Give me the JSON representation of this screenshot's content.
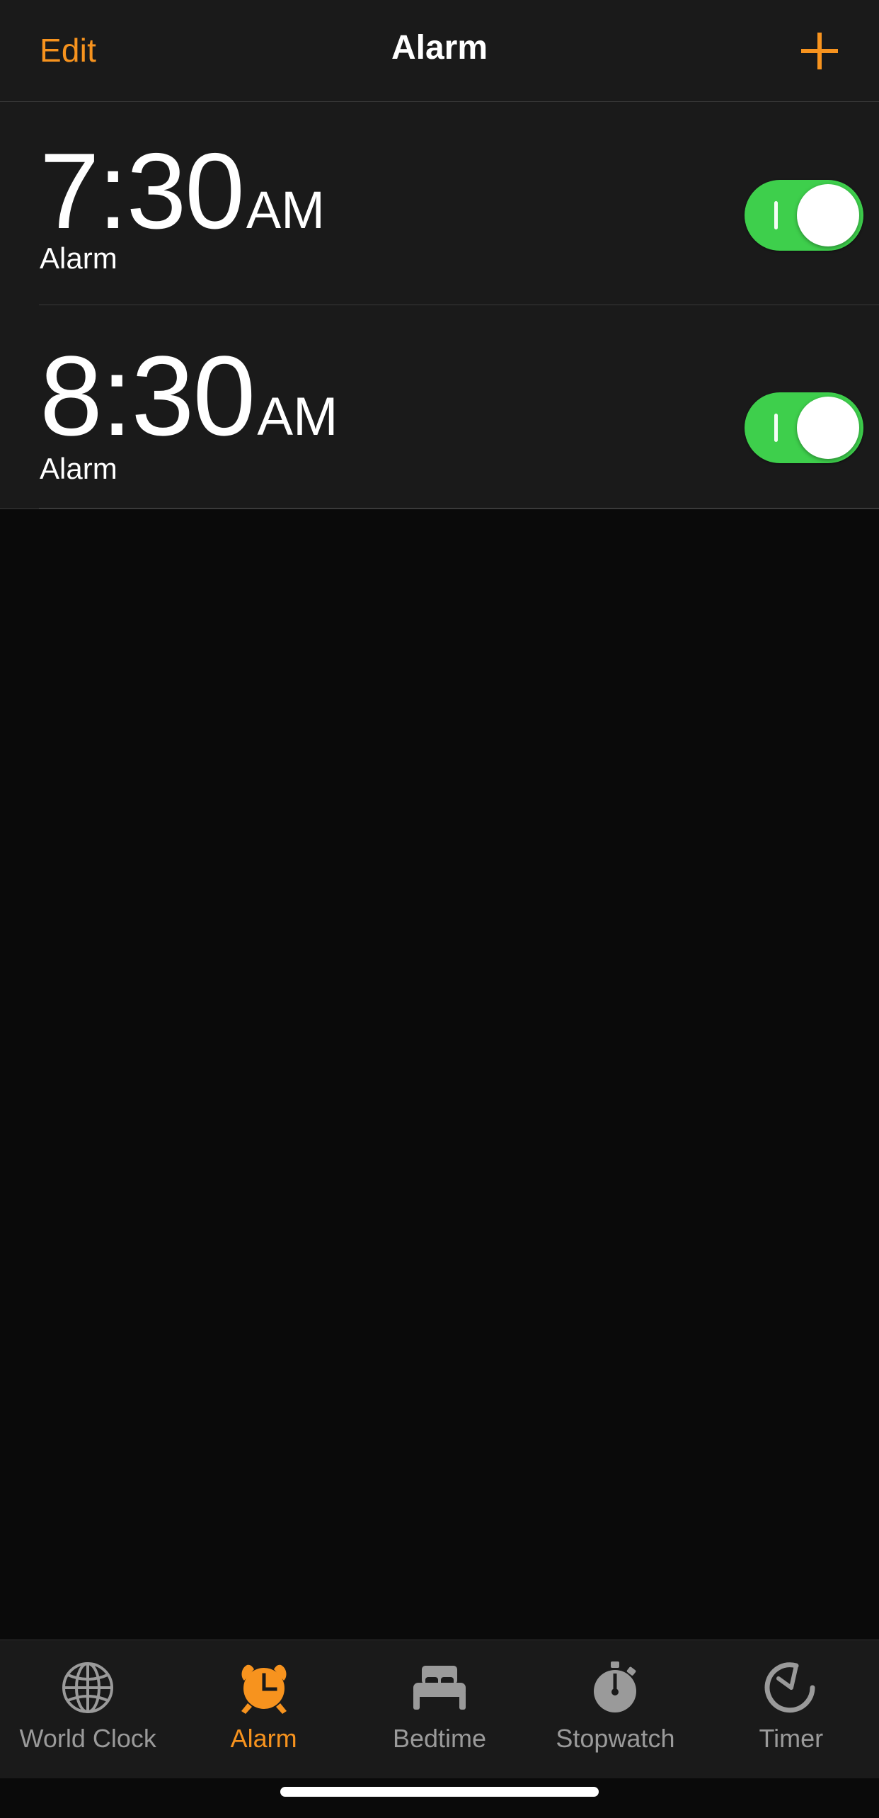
{
  "colors": {
    "accent": "#f7931e",
    "toggle_on": "#3ecf4c",
    "row_background": "#1a1a1a",
    "screen_background": "#0a0a0a",
    "inactive_tab": "#9a9a9a",
    "divider": "#3a3a3a",
    "text_primary": "#ffffff"
  },
  "navbar": {
    "edit_label": "Edit",
    "title": "Alarm",
    "add_icon": "plus-icon"
  },
  "alarms": [
    {
      "time": "7:30",
      "period": "AM",
      "label": "Alarm",
      "enabled": true,
      "toggle_state": "on"
    },
    {
      "time": "8:30",
      "period": "AM",
      "label": "Alarm",
      "enabled": true,
      "toggle_state": "on"
    }
  ],
  "tabbar": {
    "active_index": 1,
    "items": [
      {
        "label": "World Clock",
        "icon": "globe-icon",
        "active": false
      },
      {
        "label": "Alarm",
        "icon": "alarm-clock-icon",
        "active": true
      },
      {
        "label": "Bedtime",
        "icon": "bed-icon",
        "active": false
      },
      {
        "label": "Stopwatch",
        "icon": "stopwatch-icon",
        "active": false
      },
      {
        "label": "Timer",
        "icon": "timer-icon",
        "active": false
      }
    ]
  },
  "home_indicator": "home-indicator-bar"
}
